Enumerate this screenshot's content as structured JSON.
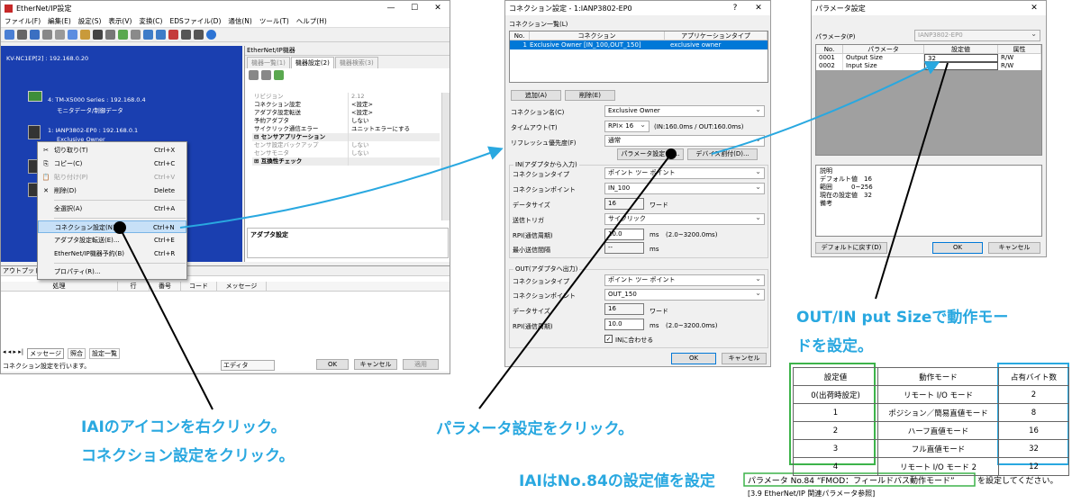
{
  "main_window": {
    "title": "EtherNet/IP設定",
    "window_controls": [
      "—",
      "☐",
      "✕"
    ],
    "menu": [
      "ファイル(F)",
      "編集(E)",
      "設定(S)",
      "表示(V)",
      "変換(C)",
      "EDSファイル(D)",
      "通信(N)",
      "ツール(T)",
      "ヘルプ(H)"
    ],
    "tree": {
      "root": "KV-NC1EP[2] : 192.168.0.20",
      "nodes": [
        {
          "name": "4: TM-X5000 Series : 192.168.0.4",
          "child": "モニタデータ/制御データ"
        },
        {
          "name": "1: IANP3802-EP0 : 192.168.0.1",
          "child": "Exclusive Owner"
        }
      ]
    },
    "device_pane": {
      "title": "EtherNet/IP機器",
      "tabs": [
        "機器一覧(1)",
        "機器設定(2)",
        "機器検索(3)"
      ],
      "properties": [
        {
          "k": "リビジョン",
          "v": "2.12",
          "style": "dim"
        },
        {
          "k": "コネクション設定",
          "v": "<設定>",
          "style": ""
        },
        {
          "k": "アダプタ設定転送",
          "v": "<設定>",
          "style": ""
        },
        {
          "k": "予約アダプタ",
          "v": "しない",
          "style": ""
        },
        {
          "k": "サイクリック通信エラー",
          "v": "ユニットエラーにする",
          "style": ""
        },
        {
          "k": "⊟ センサアプリケーション",
          "v": "",
          "style": "cat"
        },
        {
          "k": "センサ設定バックアップ",
          "v": "しない",
          "style": "dim"
        },
        {
          "k": "センサモニタ",
          "v": "しない",
          "style": "dim"
        },
        {
          "k": "⊞ 互換性チェック",
          "v": "",
          "style": "cat"
        }
      ],
      "description_title": "アダプタ設定"
    },
    "context_menu": [
      {
        "icon": "✂",
        "label": "切り取り(T)",
        "shortcut": "Ctrl+X",
        "state": ""
      },
      {
        "icon": "⎘",
        "label": "コピー(C)",
        "shortcut": "Ctrl+C",
        "state": ""
      },
      {
        "icon": "📋",
        "label": "貼り付け(P)",
        "shortcut": "Ctrl+V",
        "state": "dim"
      },
      {
        "icon": "✕",
        "label": "削除(D)",
        "shortcut": "Delete",
        "state": ""
      },
      {
        "icon": "",
        "label": "全選択(A)",
        "shortcut": "Ctrl+A",
        "state": ""
      },
      {
        "icon": "",
        "label": "コネクション設定(N)...",
        "shortcut": "Ctrl+N",
        "state": "hl"
      },
      {
        "icon": "",
        "label": "アダプタ設定転送(E)...",
        "shortcut": "Ctrl+E",
        "state": ""
      },
      {
        "icon": "",
        "label": "EtherNet/IP機器予約(B)",
        "shortcut": "Ctrl+R",
        "state": ""
      },
      {
        "icon": "",
        "label": "プロパティ(R)...",
        "shortcut": "",
        "state": ""
      }
    ],
    "output_pane": {
      "title": "アウトプット",
      "columns": [
        "処理",
        "行",
        "番号",
        "コード",
        "メッセージ"
      ],
      "tabs": [
        "メッセージ",
        "照合",
        "設定一覧"
      ]
    },
    "status": {
      "text": "コネクション設定を行います。",
      "mode": "エディタ"
    },
    "footer_buttons": [
      "OK",
      "キャンセル",
      "適用"
    ]
  },
  "connection_dialog": {
    "title": "コネクション設定 - 1:IANP3802-EP0",
    "title_controls": [
      "?",
      "✕"
    ],
    "list_label": "コネクション一覧(L)",
    "list_columns": [
      "No.",
      "コネクション",
      "アプリケーションタイプ"
    ],
    "list_row": {
      "no": "1",
      "connection": "Exclusive Owner [IN_100,OUT_150]",
      "app_type": "exclusive owner"
    },
    "add_button": "追加(A)",
    "delete_button": "削除(E)",
    "connection_name_label": "コネクション名(C)",
    "connection_name": "Exclusive Owner",
    "timeout_label": "タイムアウト(T)",
    "timeout_value": "RPI× 16",
    "timeout_note": "(IN:160.0ms / OUT:160.0ms)",
    "refresh_label": "リフレッシュ優先度(F)",
    "refresh_value": "通常",
    "param_button": "パラメータ設定(P)...",
    "device_alloc_button": "デバイス割付(D)...",
    "in_group": {
      "title": "IN(アダプタから入力)",
      "type_label": "コネクションタイプ",
      "type_value": "ポイント ツー ポイント",
      "point_label": "コネクションポイント",
      "point_value": "IN_100",
      "size_label": "データサイズ",
      "size_value": "16",
      "size_unit": "ワード",
      "trigger_label": "送信トリガ",
      "trigger_value": "サイクリック",
      "rpi_label": "RPI(通信周期)",
      "rpi_value": "10.0",
      "rpi_unit": "ms",
      "rpi_range": "(2.0~3200.0ms)",
      "min_label": "最小送信間隔",
      "min_value": "--",
      "min_unit": "ms"
    },
    "out_group": {
      "title": "OUT(アダプタへ出力)",
      "type_label": "コネクションタイプ",
      "type_value": "ポイント ツー ポイント",
      "point_label": "コネクションポイント",
      "point_value": "OUT_150",
      "size_label": "データサイズ",
      "size_value": "16",
      "size_unit": "ワード",
      "rpi_label": "RPI(通信周期)",
      "rpi_value": "10.0",
      "rpi_unit": "ms",
      "rpi_range": "(2.0~3200.0ms)",
      "match_in": "INに合わせる"
    },
    "ok": "OK",
    "cancel": "キャンセル"
  },
  "param_dialog": {
    "title": "パラメータ設定",
    "param_label": "パラメータ(P)",
    "param_value": "IANP3802-EP0",
    "columns": [
      "No.",
      "パラメータ",
      "設定値",
      "属性"
    ],
    "rows": [
      {
        "no": "0001",
        "name": "Output Size",
        "value": "32",
        "attr": "R/W"
      },
      {
        "no": "0002",
        "name": "Input Size",
        "value": "32",
        "attr": "R/W"
      }
    ],
    "desc_lines": [
      "説明",
      "デフォルト値　16",
      "範囲　　　0~256",
      "現在の設定値　32",
      "備考"
    ],
    "default_button": "デフォルトに戻す(D)",
    "ok": "OK",
    "cancel": "キャンセル"
  },
  "annotations": {
    "caption_1a": "IAIのアイコンを右クリック。",
    "caption_1b": "コネクション設定をクリック。",
    "caption_2": "パラメータ設定をクリック。",
    "caption_3a": "OUT/IN put Sizeで動作モー",
    "caption_3b": "ドを設定。",
    "footer_caption": "IAIはNo.84の設定値を設定",
    "footer_boxed": "パラメータ No.84 “FMOD：フィールドバス動作モード”",
    "footer_tail": "を設定してください。",
    "footer_ref": "[3.9 EtherNet/IP 関連パラメータ参照]",
    "accent": "#29a8e0",
    "green": "#3db34a",
    "blue_box": "#29a8e0"
  },
  "mode_table": {
    "headers": [
      "設定値",
      "動作モード",
      "占有バイト数"
    ],
    "rows": [
      [
        "0(出荷時設定)",
        "リモート I/O モード",
        "2"
      ],
      [
        "1",
        "ポジション／簡易直値モード",
        "8"
      ],
      [
        "2",
        "ハーフ直値モード",
        "16"
      ],
      [
        "3",
        "フル直値モード",
        "32"
      ],
      [
        "4",
        "リモート I/O モード 2",
        "12"
      ]
    ]
  }
}
